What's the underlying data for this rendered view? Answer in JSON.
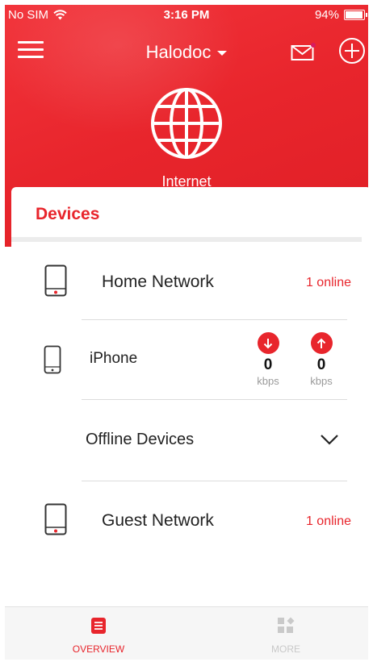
{
  "status_bar": {
    "carrier": "No SIM",
    "time": "3:16 PM",
    "battery": "94%",
    "battery_level": 0.94
  },
  "header": {
    "title": "Halodoc"
  },
  "internet": {
    "label": "Internet"
  },
  "devices": {
    "title": "Devices",
    "home_network": {
      "label": "Home Network",
      "status": "1 online"
    },
    "iphone": {
      "label": "iPhone",
      "download": {
        "value": "0",
        "unit": "kbps"
      },
      "upload": {
        "value": "0",
        "unit": "kbps"
      }
    },
    "offline": {
      "label": "Offline Devices"
    },
    "guest_network": {
      "label": "Guest Network",
      "status": "1 online"
    }
  },
  "tabs": [
    {
      "label": "OVERVIEW",
      "active": true
    },
    {
      "label": "MORE",
      "active": false
    }
  ],
  "colors": {
    "accent": "#e8252c",
    "inactive": "#c9c9c9"
  }
}
